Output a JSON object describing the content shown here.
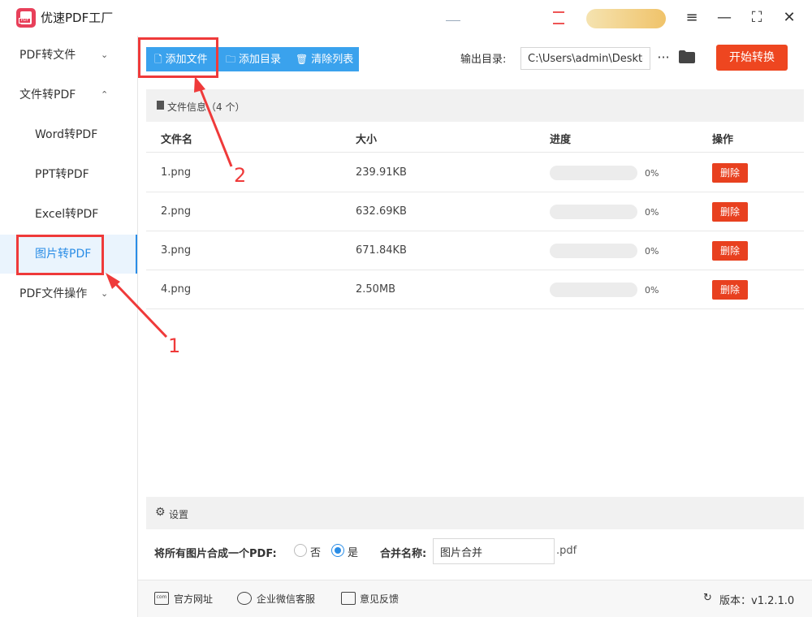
{
  "app": {
    "title": "优速PDF工厂",
    "logo_text": "PDF"
  },
  "window_controls": {
    "menu": "≡",
    "minimize": "—",
    "maximize": "⛶",
    "close": "✕"
  },
  "sidebar": {
    "items": [
      {
        "label": "PDF转文件",
        "chevron": "⌄"
      },
      {
        "label": "文件转PDF",
        "chevron": "⌃"
      },
      {
        "label": "Word转PDF"
      },
      {
        "label": "PPT转PDF"
      },
      {
        "label": "Excel转PDF"
      },
      {
        "label": "图片转PDF",
        "active": true
      },
      {
        "label": "PDF文件操作",
        "chevron": "⌄"
      }
    ]
  },
  "toolbar": {
    "add_file": "添加文件",
    "add_folder": "添加目录",
    "clear_list": "清除列表",
    "output_label": "输出目录:",
    "output_path": "C:\\Users\\admin\\Deskto",
    "more": "···",
    "start": "开始转换"
  },
  "file_info": {
    "label": "文件信息（4 个）"
  },
  "table": {
    "headers": [
      "文件名",
      "大小",
      "进度",
      "操作"
    ],
    "rows": [
      {
        "name": "1.png",
        "size": "239.91KB",
        "progress": "0%",
        "action": "删除"
      },
      {
        "name": "2.png",
        "size": "632.69KB",
        "progress": "0%",
        "action": "删除"
      },
      {
        "name": "3.png",
        "size": "671.84KB",
        "progress": "0%",
        "action": "删除"
      },
      {
        "name": "4.png",
        "size": "2.50MB",
        "progress": "0%",
        "action": "删除"
      }
    ]
  },
  "settings": {
    "label": "设置",
    "merge_label": "将所有图片合成一个PDF:",
    "option_no": "否",
    "option_yes": "是",
    "selected": "是",
    "name_label": "合并名称:",
    "name_value": "图片合并",
    "ext": ".pdf"
  },
  "footer": {
    "website": "官方网址",
    "wechat": "企业微信客服",
    "feedback": "意见反馈",
    "version": "版本：v1.2.1.0"
  },
  "annotations": {
    "label_1": "1",
    "label_2": "2",
    "color": "#ef3a3a"
  },
  "colors": {
    "accent": "#3aa2ed",
    "danger": "#ee4620",
    "active_nav": "#2a8de6"
  }
}
